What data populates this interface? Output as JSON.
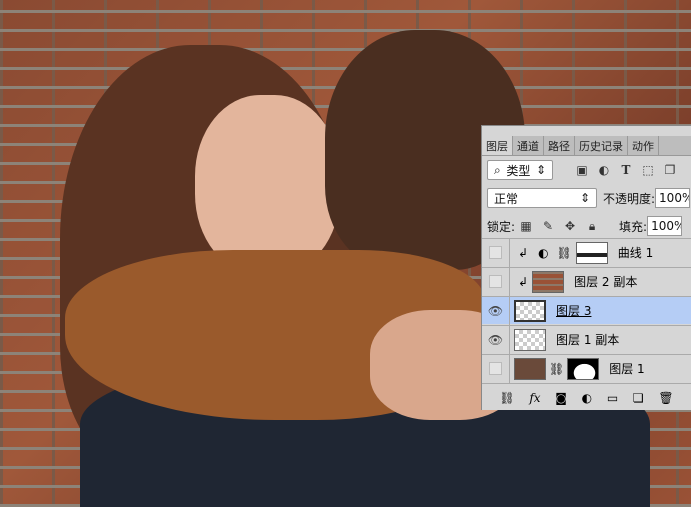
{
  "panel": {
    "tabs": [
      "图层",
      "通道",
      "路径",
      "历史记录",
      "动作"
    ],
    "filter": {
      "label": "类型",
      "icons": [
        "image-filter-icon",
        "adjustment-filter-icon",
        "text-filter-icon",
        "shape-filter-icon",
        "smart-object-filter-icon"
      ]
    },
    "blend_mode": "正常",
    "opacity_label": "不透明度:",
    "opacity_value": "100%",
    "lock_label": "锁定:",
    "fill_label": "填充:",
    "fill_value": "100%",
    "layers": [
      {
        "name": "曲线 1",
        "visible": false,
        "selected": false
      },
      {
        "name": "图层 2 副本",
        "visible": false,
        "selected": false
      },
      {
        "name": "图层 3",
        "visible": true,
        "selected": true
      },
      {
        "name": "图层 1 副本",
        "visible": true,
        "selected": false
      },
      {
        "name": "图层 1",
        "visible": false,
        "selected": false
      }
    ],
    "accent": "#b5cdf5"
  }
}
